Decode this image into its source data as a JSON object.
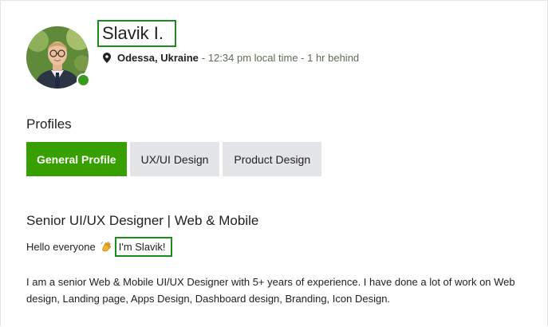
{
  "profile": {
    "name": "Slavik I.",
    "city": "Odessa, Ukraine",
    "local_time": "- 12:34 pm local time - 1 hr behind"
  },
  "profiles_section": {
    "title": "Profiles",
    "tabs": [
      {
        "label": "General Profile",
        "active": true
      },
      {
        "label": "UX/UI Design",
        "active": false
      },
      {
        "label": "Product Design",
        "active": false
      }
    ]
  },
  "overview": {
    "title": "Senior UI/UX Designer | Web & Mobile",
    "greeting_prefix": "Hello everyone",
    "greeting_highlight": "I'm Slavik!",
    "description": "I am a senior Web & Mobile UI/UX Designer with 5+ years of experience. I have done a lot of work on Web design, Landing page, Apps Design, Dashboard design, Branding, Icon Design."
  },
  "colors": {
    "accent": "#37a000",
    "online": "#3c9a1e",
    "highlight_border": "#1f8a1f",
    "tab_bg": "#e4e5e7"
  },
  "icons": [
    "location-pin-icon",
    "waving-hand-icon",
    "online-status-icon"
  ]
}
